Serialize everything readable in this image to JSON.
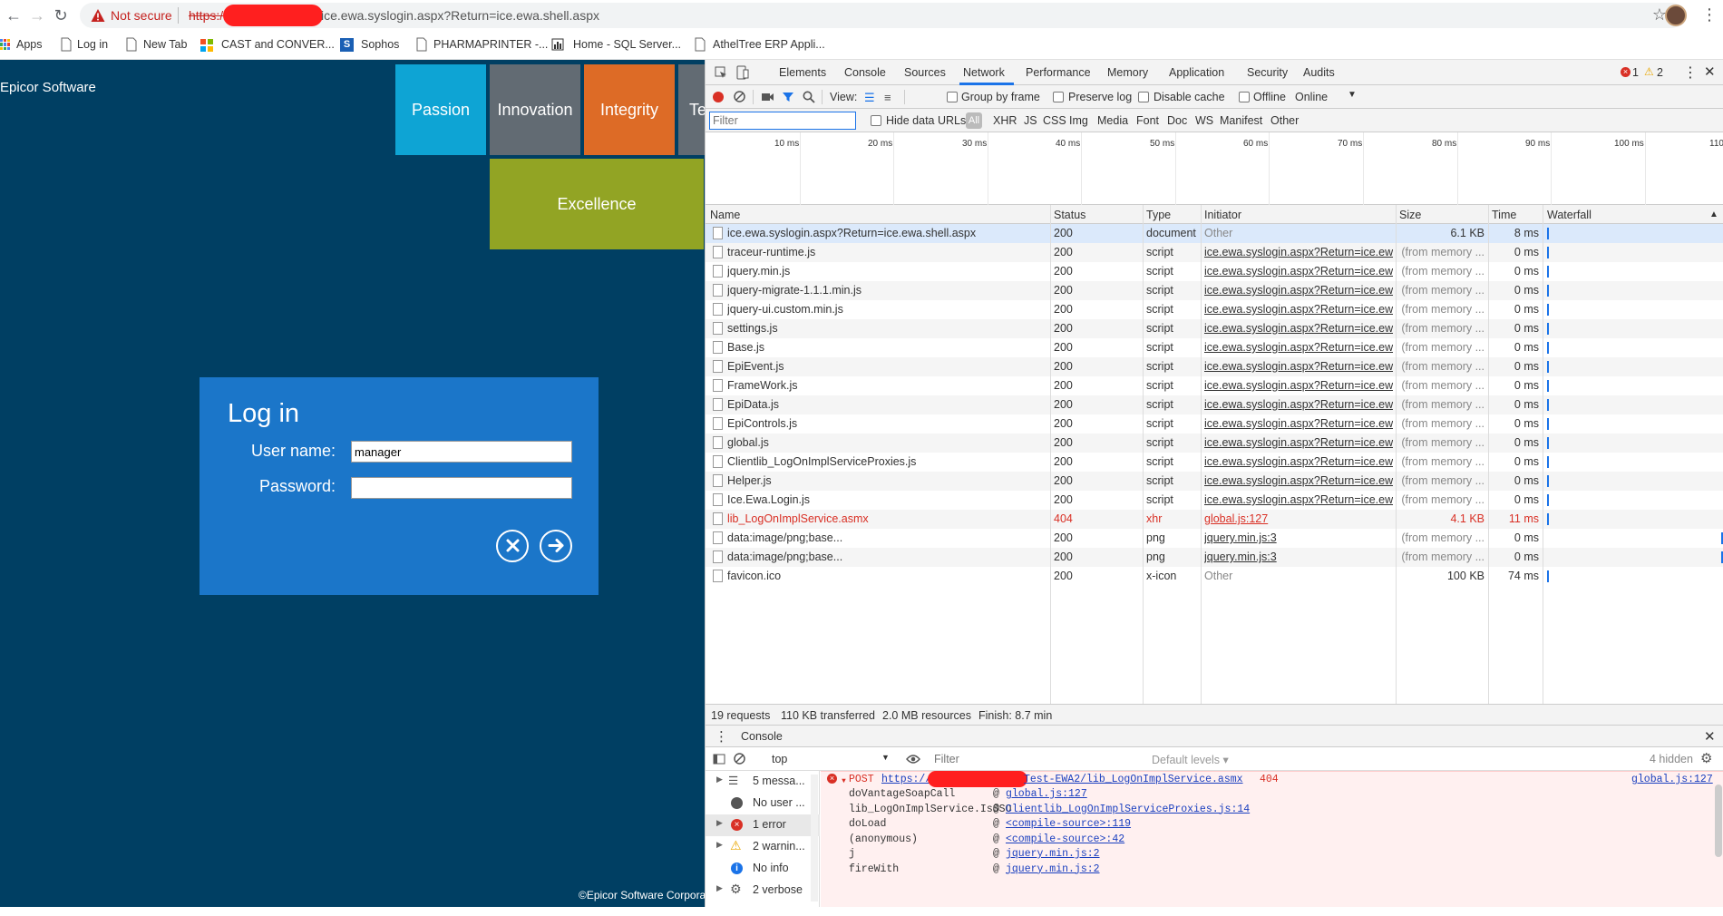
{
  "browser": {
    "security_label": "Not secure",
    "url_scheme": "https:/",
    "url_rest": "ice.ewa.syslogin.aspx?Return=ice.ewa.shell.aspx"
  },
  "bookmarks": [
    {
      "label": "Apps",
      "icon": "apps-grid-icon"
    },
    {
      "label": "Log in",
      "icon": "page-icon"
    },
    {
      "label": "New Tab",
      "icon": "page-icon"
    },
    {
      "label": "CAST and CONVER...",
      "icon": "ms-icon"
    },
    {
      "label": "Sophos",
      "icon": "sophos-icon"
    },
    {
      "label": "PHARMAPRINTER -...",
      "icon": "page-icon"
    },
    {
      "label": "Home - SQL Server...",
      "icon": "chart-icon"
    },
    {
      "label": "AthelTree ERP Appli...",
      "icon": "page-icon"
    }
  ],
  "epicor": {
    "logo_alt": "Epicor Software",
    "tiles": [
      "Passion",
      "Innovation",
      "Integrity",
      "Teamwork",
      "Excellence"
    ],
    "tile_colors": {
      "passion": "#0ea4d4",
      "innovation": "#626b73",
      "integrity": "#dd6b26",
      "teamwork": "#626b73",
      "excellence": "#92a424"
    },
    "login": {
      "title": "Log in",
      "user_label": "User name:",
      "user_value": "manager",
      "password_label": "Password:",
      "password_value": ""
    },
    "copyright": "©Epicor Software Corporation"
  },
  "devtools": {
    "tabs": [
      "Elements",
      "Console",
      "Sources",
      "Network",
      "Performance",
      "Memory",
      "Application",
      "Security",
      "Audits"
    ],
    "active_tab": "Network",
    "error_count": "1",
    "warning_count": "2",
    "toolbar": {
      "view_label": "View:",
      "group_by_frame": "Group by frame",
      "preserve_log": "Preserve log",
      "disable_cache": "Disable cache",
      "offline": "Offline",
      "throttle": "Online"
    },
    "filter": {
      "placeholder": "Filter",
      "hide_data_urls": "Hide data URLs",
      "types": [
        "All",
        "XHR",
        "JS",
        "CSS",
        "Img",
        "Media",
        "Font",
        "Doc",
        "WS",
        "Manifest",
        "Other"
      ]
    },
    "timeline_ticks": [
      "10 ms",
      "20 ms",
      "30 ms",
      "40 ms",
      "50 ms",
      "60 ms",
      "70 ms",
      "80 ms",
      "90 ms",
      "100 ms",
      "110"
    ],
    "columns": [
      "Name",
      "Status",
      "Type",
      "Initiator",
      "Size",
      "Time",
      "Waterfall"
    ],
    "requests": [
      {
        "name": "ice.ewa.syslogin.aspx?Return=ice.ewa.shell.aspx",
        "status": "200",
        "type": "document",
        "initiator": "Other",
        "size": "6.1 KB",
        "time": "8 ms"
      },
      {
        "name": "traceur-runtime.js",
        "status": "200",
        "type": "script",
        "initiator": "ice.ewa.syslogin.aspx?Return=ice.ewa...",
        "size": "(from memory ...",
        "time": "0 ms"
      },
      {
        "name": "jquery.min.js",
        "status": "200",
        "type": "script",
        "initiator": "ice.ewa.syslogin.aspx?Return=ice.ewa...",
        "size": "(from memory ...",
        "time": "0 ms"
      },
      {
        "name": "jquery-migrate-1.1.1.min.js",
        "status": "200",
        "type": "script",
        "initiator": "ice.ewa.syslogin.aspx?Return=ice.ewa...",
        "size": "(from memory ...",
        "time": "0 ms"
      },
      {
        "name": "jquery-ui.custom.min.js",
        "status": "200",
        "type": "script",
        "initiator": "ice.ewa.syslogin.aspx?Return=ice.ewa...",
        "size": "(from memory ...",
        "time": "0 ms"
      },
      {
        "name": "settings.js",
        "status": "200",
        "type": "script",
        "initiator": "ice.ewa.syslogin.aspx?Return=ice.ewa...",
        "size": "(from memory ...",
        "time": "0 ms"
      },
      {
        "name": "Base.js",
        "status": "200",
        "type": "script",
        "initiator": "ice.ewa.syslogin.aspx?Return=ice.ewa...",
        "size": "(from memory ...",
        "time": "0 ms"
      },
      {
        "name": "EpiEvent.js",
        "status": "200",
        "type": "script",
        "initiator": "ice.ewa.syslogin.aspx?Return=ice.ewa...",
        "size": "(from memory ...",
        "time": "0 ms"
      },
      {
        "name": "FrameWork.js",
        "status": "200",
        "type": "script",
        "initiator": "ice.ewa.syslogin.aspx?Return=ice.ewa...",
        "size": "(from memory ...",
        "time": "0 ms"
      },
      {
        "name": "EpiData.js",
        "status": "200",
        "type": "script",
        "initiator": "ice.ewa.syslogin.aspx?Return=ice.ewa...",
        "size": "(from memory ...",
        "time": "0 ms"
      },
      {
        "name": "EpiControls.js",
        "status": "200",
        "type": "script",
        "initiator": "ice.ewa.syslogin.aspx?Return=ice.ewa...",
        "size": "(from memory ...",
        "time": "0 ms"
      },
      {
        "name": "global.js",
        "status": "200",
        "type": "script",
        "initiator": "ice.ewa.syslogin.aspx?Return=ice.ewa...",
        "size": "(from memory ...",
        "time": "0 ms"
      },
      {
        "name": "Clientlib_LogOnImplServiceProxies.js",
        "status": "200",
        "type": "script",
        "initiator": "ice.ewa.syslogin.aspx?Return=ice.ewa...",
        "size": "(from memory ...",
        "time": "0 ms"
      },
      {
        "name": "Helper.js",
        "status": "200",
        "type": "script",
        "initiator": "ice.ewa.syslogin.aspx?Return=ice.ewa...",
        "size": "(from memory ...",
        "time": "0 ms"
      },
      {
        "name": "Ice.Ewa.Login.js",
        "status": "200",
        "type": "script",
        "initiator": "ice.ewa.syslogin.aspx?Return=ice.ewa...",
        "size": "(from memory ...",
        "time": "0 ms"
      },
      {
        "name": "lib_LogOnImplService.asmx",
        "status": "404",
        "type": "xhr",
        "initiator": "global.js:127",
        "size": "4.1 KB",
        "time": "11 ms",
        "error": true
      },
      {
        "name": "data:image/png;base...",
        "status": "200",
        "type": "png",
        "initiator": "jquery.min.js:3",
        "size": "(from memory ...",
        "time": "0 ms"
      },
      {
        "name": "data:image/png;base...",
        "status": "200",
        "type": "png",
        "initiator": "jquery.min.js:3",
        "size": "(from memory ...",
        "time": "0 ms"
      },
      {
        "name": "favicon.ico",
        "status": "200",
        "type": "x-icon",
        "initiator": "Other",
        "size": "100 KB",
        "time": "74 ms"
      }
    ],
    "summary": {
      "requests": "19 requests",
      "transferred": "110 KB transferred",
      "resources": "2.0 MB resources",
      "finish": "Finish: 8.7 min"
    },
    "console": {
      "tab_label": "Console",
      "context": "top",
      "filter_placeholder": "Filter",
      "levels": "Default levels ▾",
      "hidden": "4 hidden",
      "sidebar": [
        {
          "label": "5 messa...",
          "icon": "list-icon"
        },
        {
          "label": "No user ...",
          "icon": "user-icon"
        },
        {
          "label": "1 error",
          "icon": "error-icon"
        },
        {
          "label": "2 warnin...",
          "icon": "warning-icon"
        },
        {
          "label": "No info",
          "icon": "info-icon"
        },
        {
          "label": "2 verbose",
          "icon": "bug-icon"
        }
      ],
      "error_line": {
        "method": "POST",
        "url_start": "https://",
        "url_end": "Test-EWA2/lib_LogOnImplService.asmx",
        "status": "404",
        "source": "global.js:127"
      },
      "stack": [
        {
          "fn": "doVantageSoapCall",
          "loc": "global.js:127"
        },
        {
          "fn": "lib_LogOnImplService.IsSSO",
          "loc": "Clientlib_LogOnImplServiceProxies.js:14"
        },
        {
          "fn": "doLoad",
          "loc": "<compile-source>:119"
        },
        {
          "fn": "(anonymous)",
          "loc": "<compile-source>:42"
        },
        {
          "fn": "j",
          "loc": "jquery.min.js:2"
        },
        {
          "fn": "fireWith",
          "loc": "jquery.min.js:2"
        }
      ]
    }
  }
}
